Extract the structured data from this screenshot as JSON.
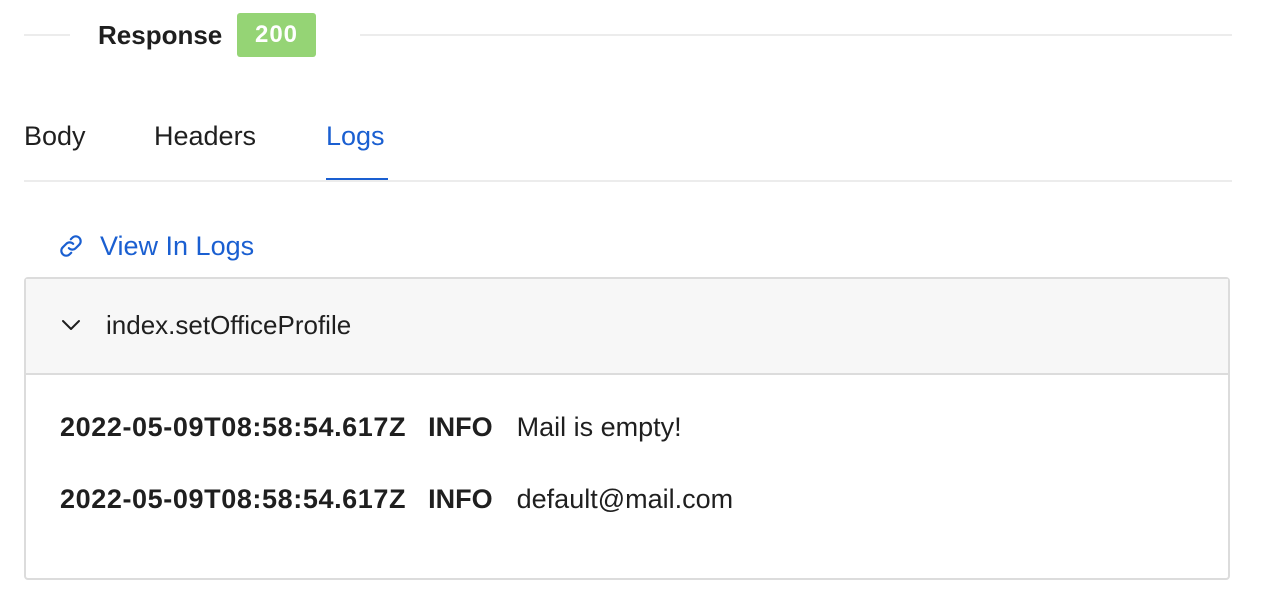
{
  "response": {
    "title": "Response",
    "status_code": "200",
    "status_color": "#95d475"
  },
  "tabs": [
    {
      "label": "Body",
      "active": false
    },
    {
      "label": "Headers",
      "active": false
    },
    {
      "label": "Logs",
      "active": true
    }
  ],
  "accent_color": "#1a5fd1",
  "view_link": {
    "label": "View In Logs",
    "icon": "link-icon"
  },
  "log_group": {
    "name": "index.setOfficeProfile",
    "expanded": true,
    "icon": "chevron-down-icon",
    "entries": [
      {
        "timestamp": "2022-05-09T08:58:54.617Z",
        "level": "INFO",
        "message": "Mail is empty!"
      },
      {
        "timestamp": "2022-05-09T08:58:54.617Z",
        "level": "INFO",
        "message": "default@mail.com"
      }
    ]
  }
}
